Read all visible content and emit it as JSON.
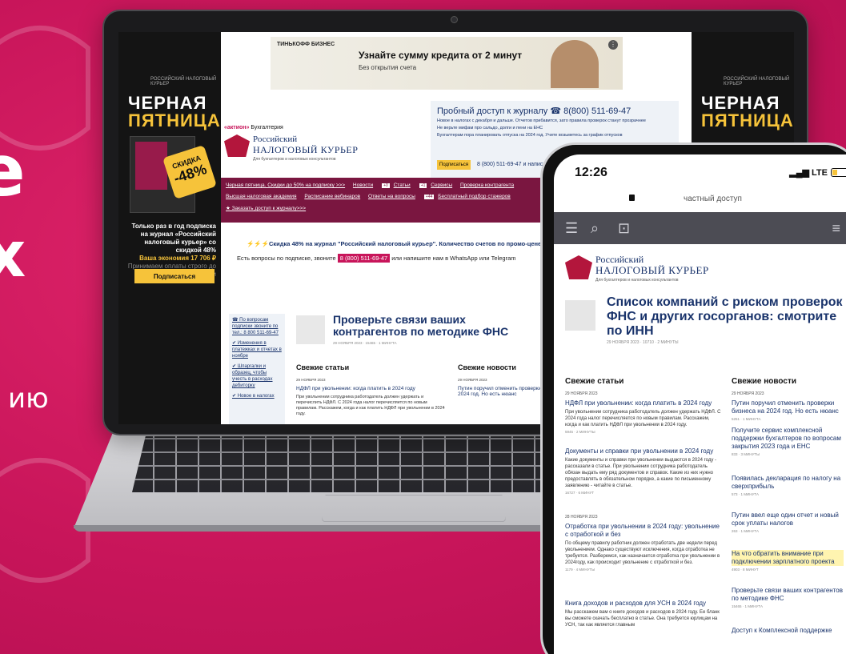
{
  "background": {
    "accent": "#c8155a",
    "fragment_1": "e",
    "fragment_2": "х",
    "fragment_3": "ию"
  },
  "laptop": {
    "side_banner": {
      "logo": "РОССИЙСКИЙ НАЛОГОВЫЙ КУРЬЕР",
      "title_1": "ЧЕРНАЯ",
      "title_2": "ПЯТНИЦА",
      "tag_1": "СКИДКА",
      "tag_2": "-48%",
      "text": "Только раз в год подписка на журнал «Российский налоговый курьер» со скидкой 48%",
      "economy": "Ваша экономия 17 706 ₽",
      "small": "Принимаем оплаты строго до конца недели",
      "button": "Подписаться"
    },
    "ad": {
      "brand": "ТИНЬКОФФ БИЗНЕС",
      "headline": "Узнайте сумму кредита от 2 минут",
      "sub": "Без открытия счета"
    },
    "header": {
      "aktion_brand": "«актион»",
      "aktion_text": "Бухгалтерия",
      "logo_line1": "Российский",
      "logo_line2": "НАЛОГОВЫЙ КУРЬЕР",
      "logo_line3": "Для бухгалтеров и налоговых консультантов",
      "trial_title": "Пробный доступ к журналу ☎ 8(800) 511-69-47",
      "trial_items": [
        "Новое в налогах с декабря и дальше. Отчетов прибавится, зато правила проверок станут прозрачнее",
        "Не верьте мифам про сальдо, долги и пени на ЕНС",
        "Бухгалтерам пора планировать отпуска на 2024 год. Учите возьметесь за график отпусков"
      ],
      "trial_button": "Подписаться",
      "trial_phone": "8 (800) 511-69-47 и написать"
    },
    "nav": {
      "row1": [
        "Черная пятница. Скидки до 50% на подписку >>>",
        "Новости",
        "Статьи",
        "Сервисы",
        "Проверка контрагента"
      ],
      "row1_badges": [
        "+0",
        "+1"
      ],
      "row2": [
        "Высшая налоговая академия",
        "Расписание вебинаров",
        "Ответы на вопросы",
        "Бесплатный подбор стажеров"
      ],
      "row2_badge": "+44",
      "row3": "★ Заказать доступ к журналу>>>"
    },
    "promo": {
      "line": "Скидка 48% на журнал \"Российский налоговый курьер\". Количество счетов по промо-цене ограничено. С",
      "question_pre": "Есть вопросы по подписке, звоните",
      "phone": "8 (800) 511-69-47",
      "question_post": "или напишите нам в WhatsApp или Telegram"
    },
    "left_links": [
      "☎ По вопросам подписки звоните по тел.: 8 800 511-69-47",
      "✔ Изменения в платежках и отчетах в ноябре",
      "✔ Шпаргалки и образец, чтобы учесть в расходах дебиторку",
      "✔ Новое в налогах"
    ],
    "article": {
      "title": "Проверьте связи ваших контрагентов по методике ФНС",
      "date": "29 НОЯБРЯ 2023",
      "meta": "15465 · 1 МИНУТА"
    },
    "fresh_articles": "Свежие статьи",
    "fresh_news": "Свежие новости",
    "date_l": "29 НОЯБРЯ 2023",
    "date_r": "29 НОЯБРЯ 2023",
    "art_l": "НДФЛ при увольнении: когда платить в 2024 году",
    "art_r": "Путин поручил отменить проверки бизнеса на 2024 год. Но есть нюанс",
    "excerpt_l": "При увольнении сотрудника работодатель должен удержать и перечислить НДФЛ. С 2024 года налог перечисляется по новым правилам. Расскажем, когда и как платить НДФЛ при увольнении в 2024 году."
  },
  "phone": {
    "time": "12:26",
    "network": "LTE",
    "url": "частный доступ",
    "logo_line1": "Российский",
    "logo_line2": "НАЛОГОВЫЙ КУРЬЕР",
    "logo_line3": "Для бухгалтеров и налоговых консультантов",
    "title": "Список компаний с риском проверок ФНС и других госорганов: смотрите по ИНН",
    "title_meta": "29 НОЯБРЯ 2023 · 10710 · 2 МИНУТЫ",
    "fresh_articles": "Свежие статьи",
    "fresh_news": "Свежие новости",
    "articles": [
      {
        "date": "29 НОЯБРЯ 2023",
        "title": "НДФЛ при увольнении: когда платить в 2024 году",
        "excerpt": "При увольнении сотрудника работодатель должен удержать НДФЛ. С 2024 года налог перечисляется по новым правилам. Расскажем, когда и как платить НДФЛ при увольнении в 2024 году.",
        "meta": "5945 · 2 МИНУТЫ"
      },
      {
        "date": "",
        "title": "Документы и справки при увольнении в 2024 году",
        "excerpt": "Какие документы и справки при увольнении выдаются в 2024 году - рассказали в статье. При увольнении сотрудника работодатель обязан выдать ему ряд документов и справок. Какие из них нужно предоставлять в обязательном порядке, а какие по письменному заявлению - читайте в статье.",
        "meta": "16727 · 6 МИНУТ"
      },
      {
        "date": "28 НОЯБРЯ 2023",
        "title": "Отработка при увольнении в 2024 году: увольнение с отработкой и без",
        "excerpt": "По общему правилу работник должен отработать две недели перед увольнением. Однако существуют исключения, когда отработка не требуется. Разберемся, как назначается отработка при увольнении в 2024году, как происходит увольнение с отработкой и без.",
        "meta": "1179 · 4 МИНУТЫ"
      },
      {
        "date": "",
        "title": "Книга доходов и расходов для УСН в 2024 году",
        "excerpt": "Мы расскажем вам о книге доходов и расходов в 2024 году. Ее бланк вы сможете скачать бесплатно в статье. Она требуется юрлицам на УСН, так как является главным",
        "meta": ""
      }
    ],
    "news": [
      {
        "date": "29 НОЯБРЯ 2023",
        "title": "Путин поручил отменить проверки бизнеса на 2024 год. Но есть нюанс",
        "meta": "5251 · 1 МИНУТА"
      },
      {
        "date": "",
        "title": "Получите сервис комплексной поддержки бухгалтеров по вопросам закрытия 2023 года и ЕНС",
        "meta": "833 · 3 МИНУТЫ"
      },
      {
        "date": "",
        "title": "Появилась декларация по налогу на сверхприбыль",
        "meta": "573 · 1 МИНУТА"
      },
      {
        "date": "",
        "title": "Путин ввел еще один отчет и новый срок уплаты налогов",
        "meta": "263 · 1 МИНУТА"
      },
      {
        "date": "",
        "title": "На что обратить внимание при подключении зарплатного проекта",
        "meta": "4903 · 8 МИНУТ"
      },
      {
        "date": "",
        "title": "Проверьте связи ваших контрагентов по методике ФНС",
        "meta": "15465 · 1 МИНУТА"
      },
      {
        "date": "",
        "title": "Доступ к Комплексной поддержке",
        "meta": ""
      }
    ]
  }
}
